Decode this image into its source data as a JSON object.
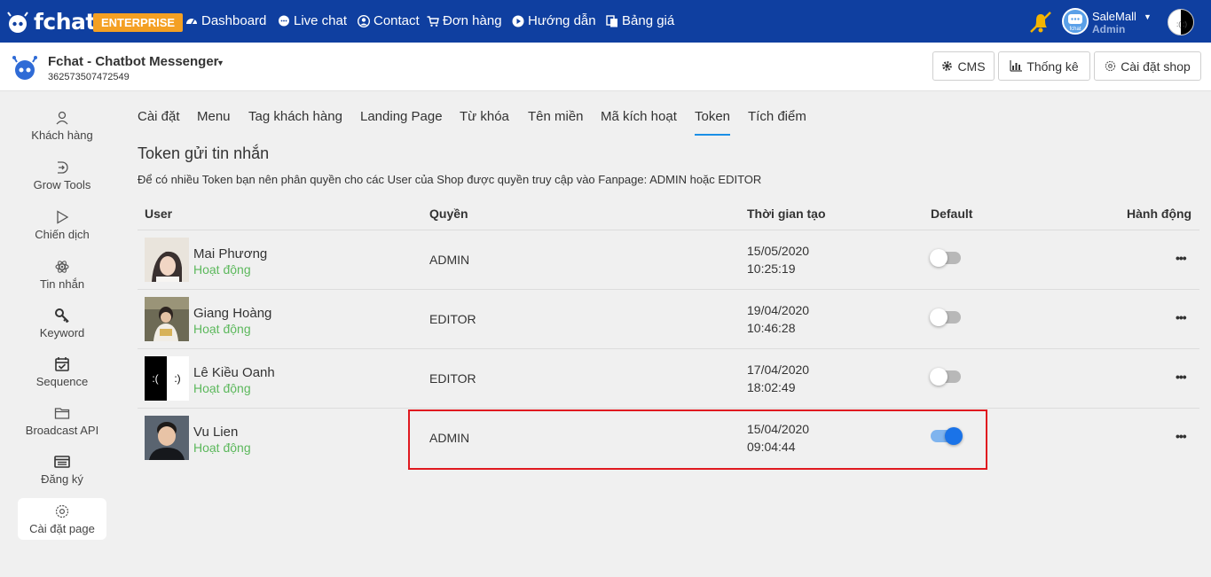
{
  "topnav": {
    "brand": "fchat",
    "badge": "ENTERPRISE",
    "items": [
      {
        "label": "Dashboard",
        "icon": "dashboard-icon"
      },
      {
        "label": "Live chat",
        "icon": "chat-bubble-icon"
      },
      {
        "label": "Contact",
        "icon": "user-circle-icon"
      },
      {
        "label": "Đơn hàng",
        "icon": "cart-icon"
      },
      {
        "label": "Hướng dẫn",
        "icon": "play-circle-icon"
      },
      {
        "label": "Bảng giá",
        "icon": "document-copy-icon"
      }
    ],
    "shop_name": "SaleMall",
    "shop_role": "Admin",
    "shop_avatar_text": "fchat",
    "user_avatar_text": ":( :)"
  },
  "page": {
    "title": "Fchat - Chatbot Messenger",
    "id": "362573507472549",
    "buttons": [
      {
        "label": "CMS",
        "icon": "gear-icon"
      },
      {
        "label": "Thống kê",
        "icon": "bar-chart-icon"
      },
      {
        "label": "Cài đặt shop",
        "icon": "settings-outline-icon"
      }
    ]
  },
  "sidebar": {
    "items": [
      {
        "label": "Khách hàng",
        "icon": "user-icon"
      },
      {
        "label": "Grow Tools",
        "icon": "grow-tools-icon"
      },
      {
        "label": "Chiến dịch",
        "icon": "play-icon"
      },
      {
        "label": "Tin nhắn",
        "icon": "atom-icon"
      },
      {
        "label": "Keyword",
        "icon": "key-icon"
      },
      {
        "label": "Sequence",
        "icon": "calendar-check-icon"
      },
      {
        "label": "Broadcast API",
        "icon": "folder-icon"
      },
      {
        "label": "Đăng ký",
        "icon": "list-card-icon"
      },
      {
        "label": "Cài đặt page",
        "icon": "settings-icon",
        "active": true
      }
    ]
  },
  "tabs": [
    "Cài đặt",
    "Menu",
    "Tag khách hàng",
    "Landing Page",
    "Từ khóa",
    "Tên miền",
    "Mã kích hoạt",
    "Token",
    "Tích điểm"
  ],
  "active_tab": "Token",
  "section": {
    "title": "Token gửi tin nhắn",
    "description": "Để có nhiều Token bạn nên phân quyền cho các User của Shop được quyền truy cập vào Fanpage: ADMIN hoặc EDITOR"
  },
  "table": {
    "headers": [
      "User",
      "Quyền",
      "Thời gian tạo",
      "Default",
      "Hành động"
    ],
    "rows": [
      {
        "name": "Mai Phương",
        "status": "Hoạt động",
        "role": "ADMIN",
        "date": "15/05/2020",
        "time": "10:25:19",
        "default": false,
        "action": "•••"
      },
      {
        "name": "Giang Hoàng",
        "status": "Hoạt động",
        "role": "EDITOR",
        "date": "19/04/2020",
        "time": "10:46:28",
        "default": false,
        "action": "•••"
      },
      {
        "name": "Lê Kiều Oanh",
        "status": "Hoạt động",
        "role": "EDITOR",
        "date": "17/04/2020",
        "time": "18:02:49",
        "default": false,
        "action": "•••",
        "avatar_text_left": ":(",
        "avatar_text_right": ":)"
      },
      {
        "name": "Vu Lien",
        "status": "Hoạt động",
        "role": "ADMIN",
        "date": "15/04/2020",
        "time": "09:04:44",
        "default": true,
        "action": "•••"
      }
    ]
  },
  "colors": {
    "topnav_bg": "#0f3fa0",
    "badge_bg": "#f4a023",
    "active_tab_underline": "#1b8fe6",
    "status_green": "#5cb85c",
    "toggle_on": "#1a73e8",
    "highlight_border": "#e0191f"
  }
}
